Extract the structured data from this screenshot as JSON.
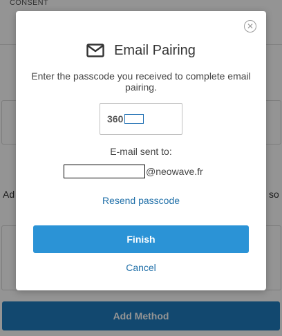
{
  "background": {
    "header_label": "CONSENT",
    "side_text_left": "Ad",
    "side_text_right": "so",
    "add_method_label": "Add Method"
  },
  "modal": {
    "title": "Email Pairing",
    "description": "Enter the passcode you received to complete email pairing.",
    "passcode_value": "360",
    "sent_label": "E-mail sent to:",
    "email_domain": "@neowave.fr",
    "resend_label": "Resend passcode",
    "finish_label": "Finish",
    "cancel_label": "Cancel",
    "close_glyph": "✕"
  },
  "colors": {
    "accent": "#2b93d6",
    "link": "#1f6fa8"
  }
}
